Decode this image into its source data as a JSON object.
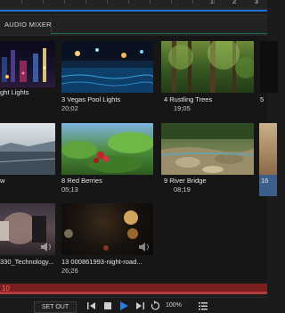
{
  "timeline": {
    "ruler_numbers": [
      "1",
      "2",
      "3"
    ]
  },
  "panel": {
    "title": "AUDIO MIXER"
  },
  "clips": [
    {
      "caption": "ght Lights",
      "duration": ""
    },
    {
      "caption": "3 Vegas Pool Lights",
      "duration": "20;02"
    },
    {
      "caption": "4 Rustling Trees",
      "duration": "19;05"
    },
    {
      "caption": "5",
      "duration": ""
    },
    {
      "caption": "w",
      "duration": ""
    },
    {
      "caption": "8 Red Berries",
      "duration": "05;13"
    },
    {
      "caption": "9 River Bridge",
      "duration": "08;19"
    },
    {
      "caption": "16",
      "duration": ""
    },
    {
      "caption": "330_Technology...",
      "duration": ""
    },
    {
      "caption": "13 000861993-night-road...",
      "duration": "26;26"
    }
  ],
  "record": {
    "counter": "10"
  },
  "transport": {
    "set_out_label": "SET OUT",
    "zoom": "100%"
  }
}
